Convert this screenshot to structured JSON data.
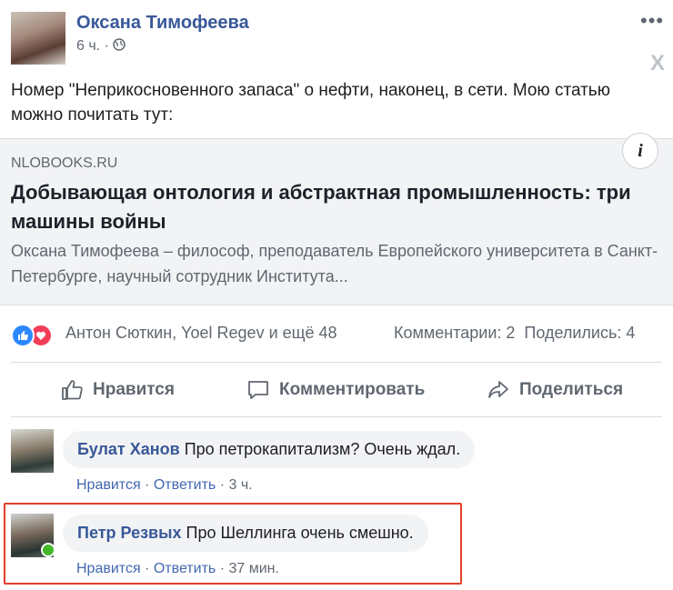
{
  "post": {
    "author": "Оксана Тимофеева",
    "time": "6 ч.",
    "separator": "·",
    "privacy_icon": "globe-icon",
    "more_icon": "more-dots-icon",
    "close_label": "X",
    "text": "Номер \"Неприкосновенного запаса\" о нефти, наконец, в сети. Мою статью можно почитать тут:"
  },
  "link": {
    "domain": "NLOBOOKS.RU",
    "title": "Добывающая онтология и абстрактная промышленность: три машины войны",
    "description": "Оксана Тимофеева – философ, преподаватель Европейского университета в Санкт-Петербурге, научный сотрудник Института...",
    "info_label": "i"
  },
  "reactions": {
    "names": "Антон Сюткин, Yoel Regev и ещё 48",
    "counts": "Комментарии: 2  Поделились: 4",
    "colors": {
      "like": "#2d88ff",
      "love": "#f33e58"
    }
  },
  "actions": {
    "like": "Нравится",
    "comment": "Комментировать",
    "share": "Поделиться"
  },
  "comments": [
    {
      "name": "Булат Ханов",
      "text": "Про петрокапитализм? Очень ждал.",
      "like": "Нравится",
      "reply": "Ответить",
      "time": "3 ч.",
      "sep": "·"
    },
    {
      "name": "Петр Резвых",
      "text": "Про Шеллинга очень смешно.",
      "like": "Нравится",
      "reply": "Ответить",
      "time": "37 мин.",
      "sep": "·"
    }
  ],
  "accent_highlight": "#e0402b"
}
